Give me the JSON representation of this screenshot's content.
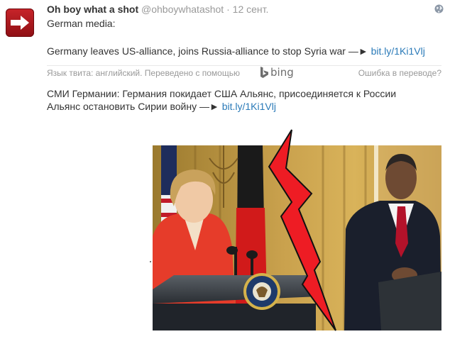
{
  "tweet": {
    "author_name": "Oh boy what a shot",
    "handle": "@ohboywhatashot",
    "separator": "·",
    "date": "12 сент.",
    "line1": "German media:",
    "line2_text": "Germany leaves US-alliance, joins Russia-alliance to stop Syria war —► ",
    "line2_link": "bit.ly/1Ki1Vlj",
    "avatar_icon": "right-arrow-icon",
    "globe_icon": "globe-icon"
  },
  "translation": {
    "note": "Язык твита: английский. Переведено с помощью",
    "provider": "bing",
    "wrong_link": "Ошибка в переводе?",
    "line1": "СМИ Германии: Германия покидает США Альянс, присоединяется к России",
    "line2_text": "Альянс остановить Сирии войну —► ",
    "line2_link": "bit.ly/1Ki1Vlj"
  },
  "colors": {
    "avatar_red": "#c8242a",
    "link_blue": "#2a7ab8",
    "muted_grey": "#999999",
    "lightning_red": "#ee1c24"
  }
}
